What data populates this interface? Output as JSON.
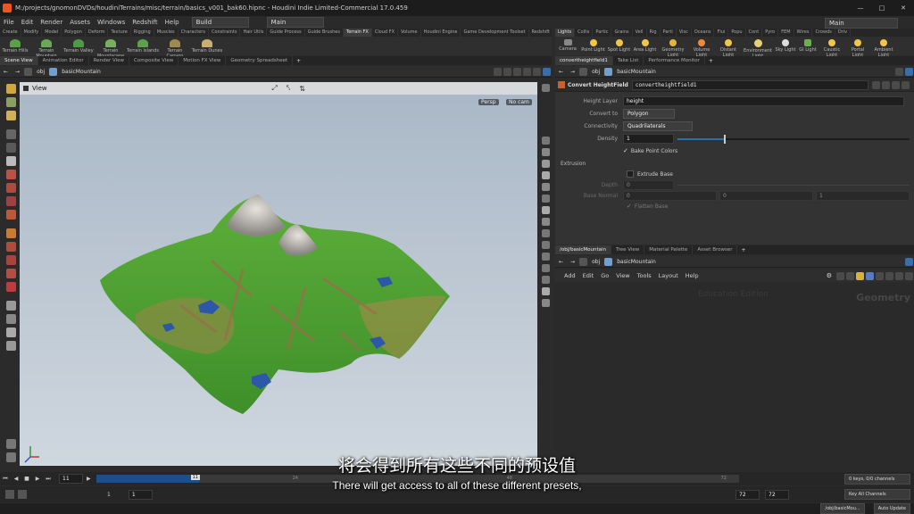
{
  "app": {
    "title": "M:/projects/gnomonDVDs/houdiniTerrains/misc/terrain/basics_v001_bak60.hipnc - Houdini Indie Limited-Commercial 17.0.459",
    "menus": [
      "File",
      "Edit",
      "Render",
      "Assets",
      "Windows",
      "Redshift",
      "Help"
    ],
    "desktop_dropdown": "Build",
    "main_dropdown": "Main",
    "right_main_dropdown": "Main"
  },
  "left_shelf": {
    "tabs": [
      "Create",
      "Modify",
      "Model",
      "Polygon",
      "Deform",
      "Texture",
      "Rigging",
      "Muscles",
      "Characters",
      "Constraints",
      "Hair Utils",
      "Guide Process",
      "Guide Brushes",
      "Terrain FX",
      "Cloud FX",
      "Volume",
      "Houdini Engine",
      "Game Development Toolset",
      "Redshift"
    ],
    "active_tab": "Terrain FX",
    "tools": [
      "Terrain Hills",
      "Terrain Mountain",
      "Terrain Valley",
      "Terrain Mountscape",
      "Terrain Islands",
      "Terrain Canyon",
      "Terrain Dunes"
    ]
  },
  "right_shelf": {
    "tabs": [
      "Lights",
      "Collis",
      "Partic",
      "Grains",
      "Vell",
      "Rig",
      "Parti",
      "Visc",
      "Oceans",
      "Flui",
      "Popu",
      "Cont",
      "Pyro",
      "FEM",
      "Wires",
      "Crowds",
      "Driv"
    ],
    "tools": [
      "Camera",
      "Point Light",
      "Spot Light",
      "Area Light",
      "Geometry Light",
      "Volume Light",
      "Distant Light",
      "Environment Light",
      "Sky Light",
      "GI Light",
      "Caustic Light",
      "Portal Light",
      "Ambient Light"
    ]
  },
  "viewport": {
    "tabs": [
      "Scene View",
      "Animation Editor",
      "Render View",
      "Composite View",
      "Motion FX View",
      "Geometry Spreadsheet"
    ],
    "path_obj": "obj",
    "path_node": "basicMountain",
    "view_label": "View",
    "persp": "Persp",
    "camera": "No cam"
  },
  "params": {
    "tabs": [
      "convertheightfield1",
      "Take List",
      "Performance Monitor"
    ],
    "path_obj": "obj",
    "path_node": "basicMountain",
    "node_type": "Convert HeightField",
    "node_name": "convertheightfield1",
    "height_layer_label": "Height Layer",
    "height_layer": "height",
    "convert_to_label": "Convert to",
    "convert_to": "Polygon",
    "connectivity_label": "Connectivity",
    "connectivity": "Quadrilaterals",
    "density_label": "Density",
    "density": "1",
    "bake_point_colors": "Bake Point Colors",
    "extrusion_label": "Extrusion",
    "extrude_base": "Extrude Base",
    "depth_label": "Depth",
    "depth_value": "0",
    "base_normal_label": "Base Normal",
    "base_normal_values": [
      "0",
      "0",
      "1"
    ],
    "flatten_base": "Flatten Base"
  },
  "network": {
    "tabs": [
      "/obj/basicMountain",
      "Tree View",
      "Material Palette",
      "Asset Browser"
    ],
    "path_obj": "obj",
    "path_node": "basicMountain",
    "menus": [
      "Add",
      "Edit",
      "Go",
      "View",
      "Tools",
      "Layout",
      "Help"
    ],
    "watermark_edition": "Education Edition",
    "watermark_context": "Geometry"
  },
  "timeline": {
    "current_frame": "11",
    "range_start": "1",
    "range_start2": "1",
    "range_end": "72",
    "range_end2": "72",
    "keys_info": "0 keys, 0/0 channels",
    "key_all": "Key All Channels",
    "ticks": [
      "24",
      "48",
      "72"
    ],
    "status_path": "/obj/basicMou...",
    "auto_update": "Auto Update"
  },
  "subtitle": {
    "zh": "将会得到所有这些不同的预设值",
    "en": "There will get access to all of these different presets,"
  },
  "colors": {
    "sky_top": "#aab8c6",
    "sky_bottom": "#cdd6df",
    "accent": "#2a6fb0"
  }
}
